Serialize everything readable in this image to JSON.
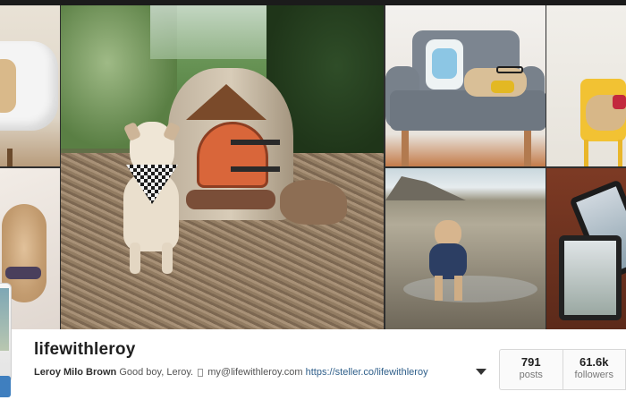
{
  "profile": {
    "username": "lifewithleroy",
    "full_name": "Leroy Milo Brown",
    "bio_text": "Good boy, Leroy.",
    "email": "my@lifewithleroy.com",
    "website": "https://steller.co/lifewithleroy"
  },
  "stats": {
    "posts_count": "791",
    "posts_label": "posts",
    "followers_count": "61.6k",
    "followers_label": "followers"
  },
  "icons": {
    "more": "chevron-down-icon",
    "bio_glyph": "envelope-icon"
  },
  "colors": {
    "link": "#2f5f8a",
    "follow_button": "#3f7fbf"
  }
}
